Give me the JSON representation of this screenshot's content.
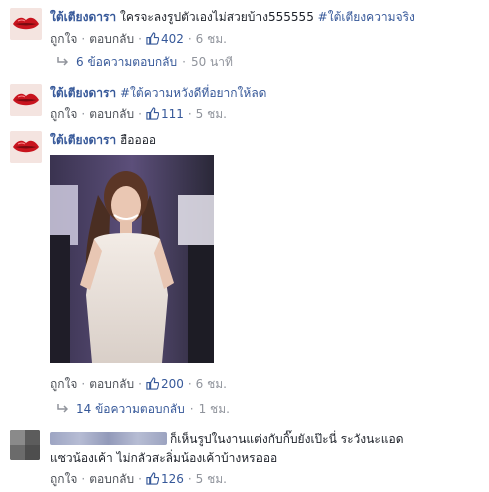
{
  "comments": [
    {
      "author": "ใต้เตียงดารา",
      "text": "ใครจะลงรูปตัวเองไม่สวยบ้าง555555",
      "hashtag": "#ใต้เตียงความจริง",
      "like_label": "ถูกใจ",
      "reply_label": "ตอบกลับ",
      "like_count": "402",
      "time": "6 ชม.",
      "replies": {
        "label": "6 ข้อความตอบกลับ",
        "time": "50 นาที"
      }
    },
    {
      "author": "ใต้เตียงดารา",
      "text": "",
      "hashtag": "#ใต้ความหวังดีที่อยากให้ลด",
      "like_label": "ถูกใจ",
      "reply_label": "ตอบกลับ",
      "like_count": "111",
      "time": "5 ชม."
    },
    {
      "author": "ใต้เตียงดารา",
      "text": "ฮืออออ",
      "like_label": "ถูกใจ",
      "reply_label": "ตอบกลับ",
      "like_count": "200",
      "time": "6 ชม.",
      "replies": {
        "label": "14 ข้อความตอบกลับ",
        "time": "1 ชม."
      }
    },
    {
      "author": "",
      "text_line1": "ก็เห็นรูปในงานแต่งกับกิ๊บยังเป๊ะนี่ ระวังนะแอด",
      "text_line2": "แซวน้องเค้า ไม่กลัวสะลิ่มน้องเค้าบ้างหรอออ",
      "like_label": "ถูกใจ",
      "reply_label": "ตอบกลับ",
      "like_count": "126",
      "time": "5 ชม."
    }
  ],
  "colors": {
    "link": "#365899",
    "meta": "#90949c",
    "text": "#1d2129"
  },
  "icons": {
    "like": "thumbs-up-icon",
    "reply_arrow": "reply-arrow-icon"
  }
}
